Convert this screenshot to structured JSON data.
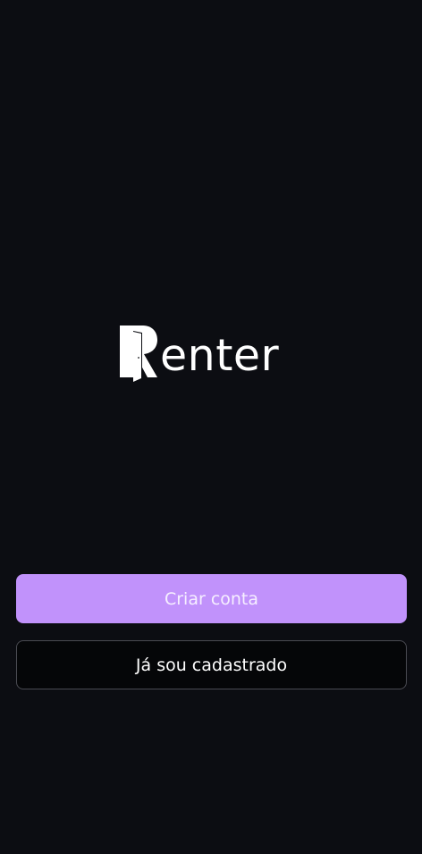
{
  "logo": {
    "text": "enter",
    "mark_icon": "door-r-icon"
  },
  "actions": {
    "create_account_label": "Criar conta",
    "already_registered_label": "Já sou cadastrado"
  },
  "colors": {
    "background": "#0c0d12",
    "primary_button": "#c192fb",
    "secondary_button_border": "#4a4b52"
  }
}
